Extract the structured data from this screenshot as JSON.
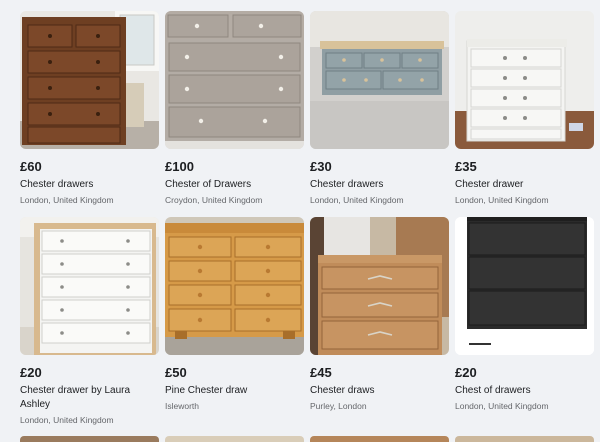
{
  "listings": [
    {
      "price": "£60",
      "title": "Chester drawers",
      "location": "London, United Kingdom",
      "image": "dark-wood-chest-of-drawers"
    },
    {
      "price": "£100",
      "title": "Chester of Drawers",
      "location": "Croydon, United Kingdom",
      "image": "grey-painted-chest-of-drawers"
    },
    {
      "price": "£30",
      "title": "Chester drawers",
      "location": "London, United Kingdom",
      "image": "low-blue-grey-pine-chest"
    },
    {
      "price": "£35",
      "title": "Chester drawer",
      "location": "London, United Kingdom",
      "image": "white-chest-of-drawers"
    },
    {
      "price": "£20",
      "title": "Chester drawer by Laura Ashley",
      "location": "London, United Kingdom",
      "image": "tall-white-chest-of-drawers"
    },
    {
      "price": "£50",
      "title": "Pine Chester draw",
      "location": "Isleworth",
      "image": "pine-chest-of-drawers"
    },
    {
      "price": "£45",
      "title": " Chester draws",
      "location": "Purley, London",
      "image": "light-wood-chest-of-drawers"
    },
    {
      "price": "£20",
      "title": "Chest of drawers",
      "location": "London, United Kingdom",
      "image": "black-chest-of-drawers"
    }
  ]
}
